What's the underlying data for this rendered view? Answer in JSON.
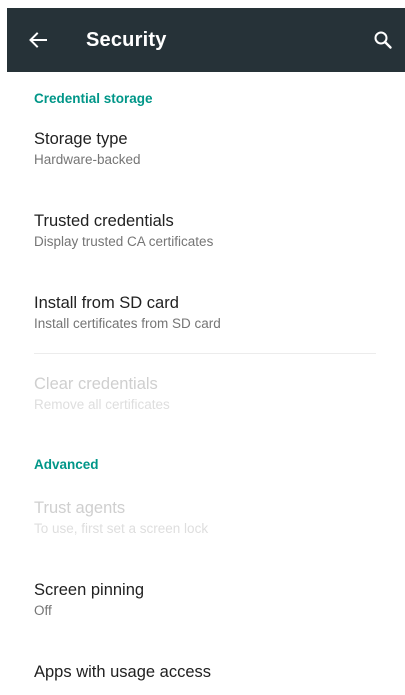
{
  "app_bar": {
    "title": "Security",
    "background": "#263238",
    "back_icon": "arrow-back-icon",
    "search_icon": "search-icon"
  },
  "accent_color": "#009688",
  "sections": [
    {
      "header": "Credential storage",
      "items": [
        {
          "label": "Storage type",
          "summary": "Hardware-backed",
          "enabled": true
        },
        {
          "label": "Trusted credentials",
          "summary": "Display trusted CA certificates",
          "enabled": true
        },
        {
          "label": "Install from SD card",
          "summary": "Install certificates from SD card",
          "enabled": true
        },
        {
          "label": "Clear credentials",
          "summary": "Remove all certificates",
          "enabled": false
        }
      ]
    },
    {
      "header": "Advanced",
      "items": [
        {
          "label": "Trust agents",
          "summary": "To use, first set a screen lock",
          "enabled": false
        },
        {
          "label": "Screen pinning",
          "summary": "Off",
          "enabled": true
        },
        {
          "label": "Apps with usage access",
          "summary": "",
          "enabled": true
        }
      ]
    }
  ]
}
